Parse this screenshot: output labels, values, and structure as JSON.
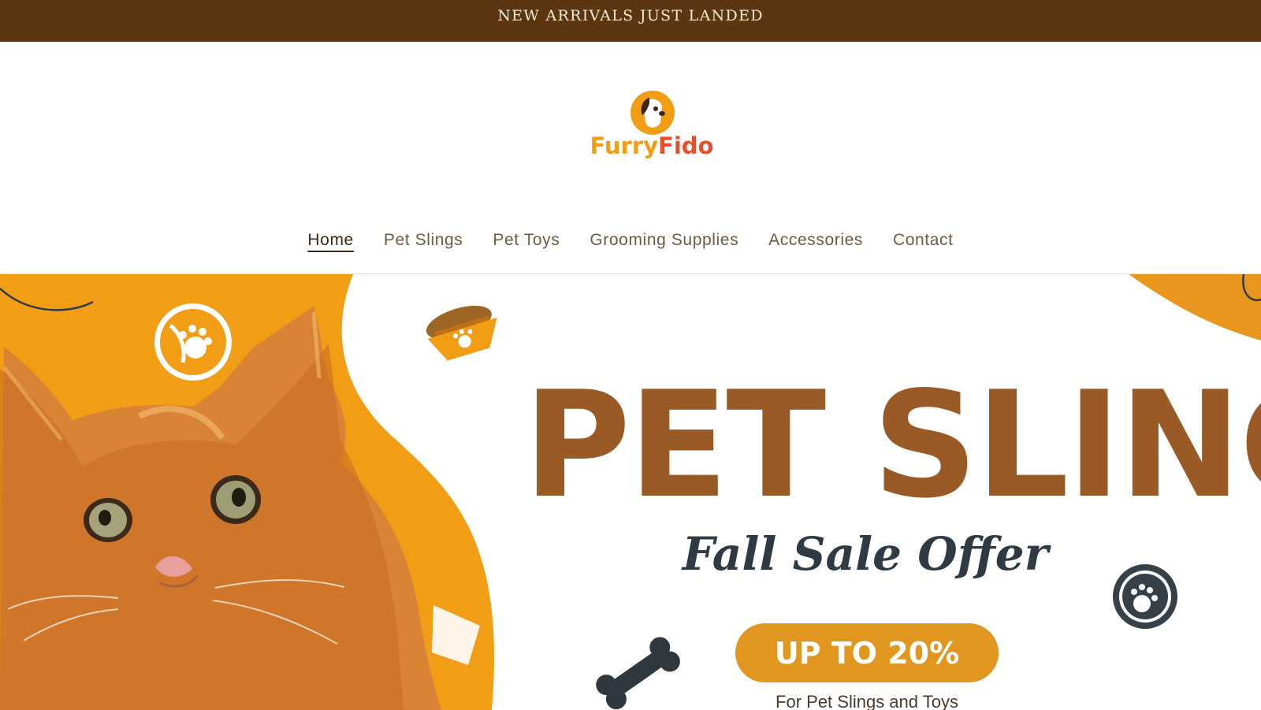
{
  "announcement": {
    "text": "NEW ARRIVALS JUST LANDED"
  },
  "brand": {
    "name_part1": "Furry",
    "name_part2": "Fido"
  },
  "nav": {
    "items": [
      {
        "label": "Home",
        "active": true
      },
      {
        "label": "Pet Slings",
        "active": false
      },
      {
        "label": "Pet Toys",
        "active": false
      },
      {
        "label": "Grooming Supplies",
        "active": false
      },
      {
        "label": "Accessories",
        "active": false
      },
      {
        "label": "Contact",
        "active": false
      }
    ]
  },
  "hero": {
    "headline": "PET SLING",
    "subheadline": "Fall Sale Offer",
    "discount": "UP TO 20%",
    "footnote": "For Pet Slings and Toys",
    "colors": {
      "orange": "#f29d16",
      "brown": "#9a5a25",
      "dark": "#2f3a45"
    }
  }
}
